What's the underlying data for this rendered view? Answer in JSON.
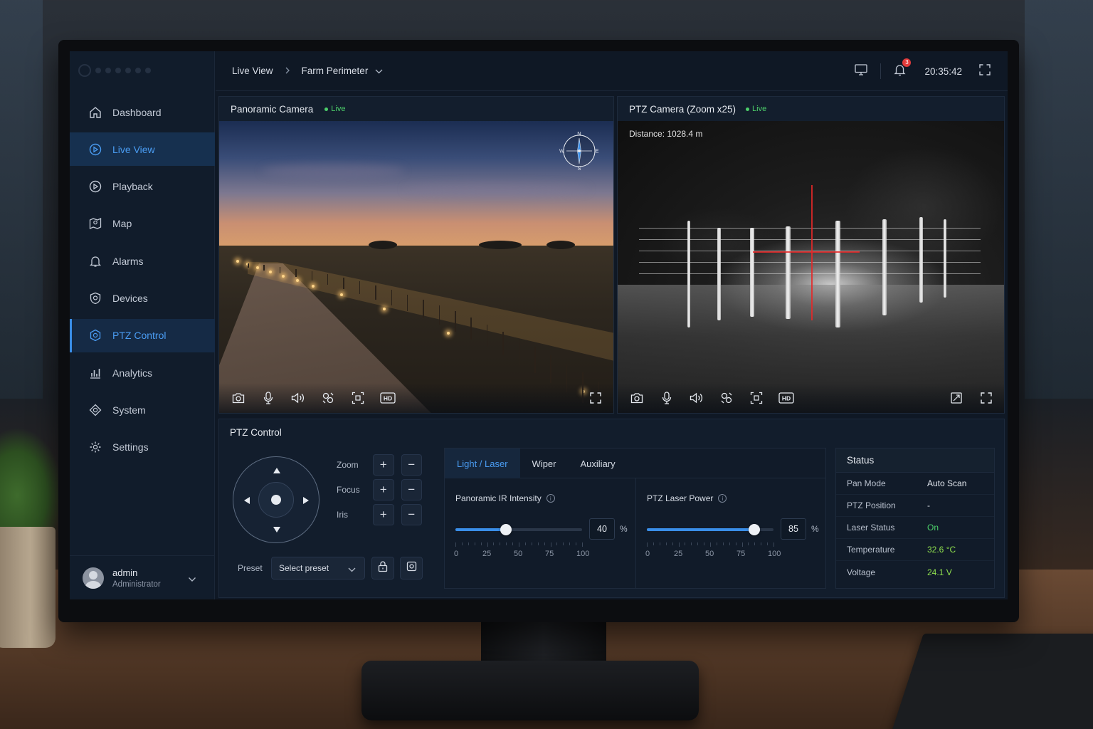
{
  "colors": {
    "accent": "#3a8ee8",
    "active_nav_text": "#4a9cf2",
    "live_green": "#4ccf6a",
    "status_green": "#8fe04e",
    "badge_red": "#e23b3b",
    "background": "#0f1825"
  },
  "sidebar": {
    "items": [
      {
        "label": "Dashboard",
        "icon": "home-icon"
      },
      {
        "label": "Live View",
        "icon": "play-circle-icon"
      },
      {
        "label": "Playback",
        "icon": "playback-icon"
      },
      {
        "label": "Map",
        "icon": "map-icon"
      },
      {
        "label": "Alarms",
        "icon": "bell-icon"
      },
      {
        "label": "Devices",
        "icon": "shield-icon"
      },
      {
        "label": "PTZ Control",
        "icon": "ptz-icon"
      },
      {
        "label": "Analytics",
        "icon": "analytics-icon"
      },
      {
        "label": "System",
        "icon": "system-icon"
      },
      {
        "label": "Settings",
        "icon": "gear-icon"
      }
    ],
    "user": {
      "name": "admin",
      "role": "Administrator"
    }
  },
  "header": {
    "breadcrumb": [
      "Live View",
      "Farm Perimeter"
    ],
    "notification_count": "3",
    "time": "20:35:42"
  },
  "cameras": {
    "panoramic": {
      "title": "Panoramic Camera",
      "status": "Live",
      "compass": {
        "n": "N",
        "e": "E",
        "s": "S",
        "w": "W"
      }
    },
    "ptz": {
      "title": "PTZ Camera (Zoom x25)",
      "status": "Live",
      "distance": "Distance: 1028.4 m"
    },
    "toolbar_icons": [
      "camera-snapshot-icon",
      "microphone-icon",
      "speaker-icon",
      "tracking-icon",
      "focus-frame-icon",
      "hd-icon",
      "fullscreen-icon"
    ],
    "hd_label": "HD"
  },
  "ptz_control": {
    "title": "PTZ Control",
    "lens": [
      {
        "label": "Zoom"
      },
      {
        "label": "Focus"
      },
      {
        "label": "Iris"
      }
    ],
    "plus": "+",
    "minus": "−",
    "preset_label": "Preset",
    "preset_value": "Select preset",
    "tabs": [
      "Light / Laser",
      "Wiper",
      "Auxiliary"
    ],
    "active_tab": "Light / Laser",
    "sliders": [
      {
        "title": "Panoramic IR Intensity",
        "value": 40,
        "unit": "%"
      },
      {
        "title": "PTZ Laser Power",
        "value": 85,
        "unit": "%"
      }
    ],
    "scale": [
      "0",
      "25",
      "50",
      "75",
      "100"
    ],
    "status": {
      "title": "Status",
      "rows": [
        {
          "key": "Pan Mode",
          "value": "Auto Scan"
        },
        {
          "key": "PTZ Position",
          "value": "-"
        },
        {
          "key": "Laser Status",
          "value": "On"
        },
        {
          "key": "Temperature",
          "value": "32.6 °C"
        },
        {
          "key": "Voltage",
          "value": "24.1 V"
        }
      ]
    }
  }
}
